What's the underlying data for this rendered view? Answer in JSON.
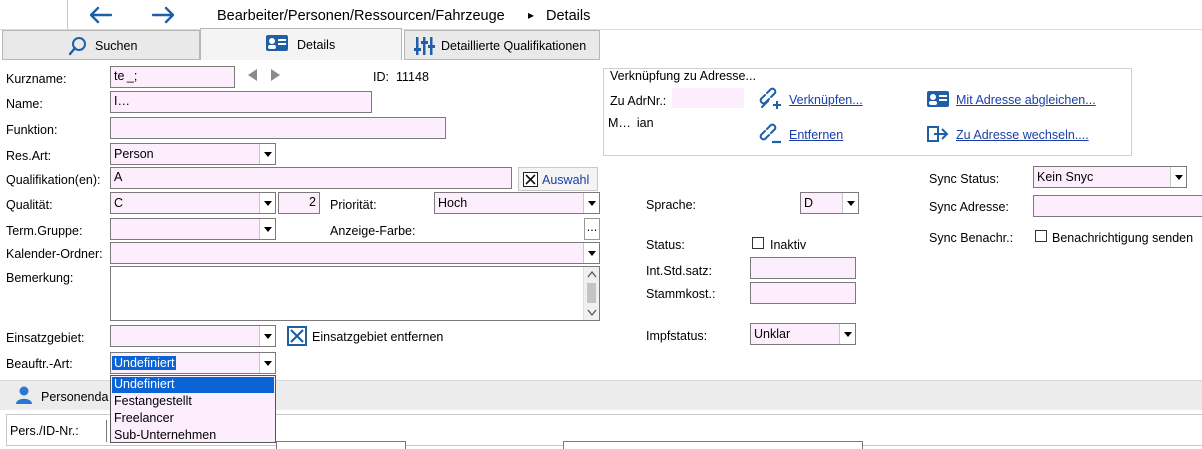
{
  "nav": {
    "back_icon": "arrow-left-icon",
    "forward_icon": "arrow-right-icon",
    "breadcrumb": "Bearbeiter/Personen/Ressourcen/Fahrzeuge",
    "crumb_separator": "▸",
    "current": "Details"
  },
  "tabs": [
    {
      "label": "Suchen",
      "icon": "search-icon"
    },
    {
      "label": "Details",
      "icon": "person-card-icon",
      "active": true
    },
    {
      "label": "Detaillierte Qualifikationen",
      "icon": "sliders-icon"
    }
  ],
  "form": {
    "kurzname_label": "Kurzname:",
    "kurzname_value": "te _;",
    "id_label": "ID:",
    "id_value": "11148",
    "name_label": "Name:",
    "name_value": "I…",
    "funktion_label": "Funktion:",
    "funktion_value": "",
    "resart_label": "Res.Art:",
    "resart_value": "Person",
    "qualifikation_label": "Qualifikation(en):",
    "qualifikation_value": "A",
    "auswahl_label": "Auswahl",
    "qualitaet_label": "Qualität:",
    "qualitaet_value": "C",
    "qualitaet_num": "2",
    "prioritaet_label": "Priorität:",
    "prioritaet_value": "Hoch",
    "termgruppe_label": "Term.Gruppe:",
    "anzeigefarbe_label": "Anzeige-Farbe:",
    "anzeigefarbe_button": "...",
    "kalender_label": "Kalender-Ordner:",
    "bemerkung_label": "Bemerkung:",
    "einsatzgebiet_label": "Einsatzgebiet:",
    "einsatzgebiet_remove": "Einsatzgebiet entfernen",
    "beauftr_label": "Beauftr.-Art:",
    "beauftr_value": "Undefiniert",
    "beauftr_options": [
      "Undefiniert",
      "Festangestellt",
      "Freelancer",
      "Sub-Unternehmen"
    ]
  },
  "address": {
    "title": "Verknüpfung zu Adresse...",
    "adrnr_label": "Zu AdrNr.:",
    "adrnr_value": "",
    "name_value": "M…  ian",
    "verknuepfen": "Verknüpfen...",
    "entfernen": "Entfernen",
    "abgleichen": "Mit Adresse abgleichen...",
    "wechseln": "Zu Adresse wechseln...."
  },
  "right": {
    "sprache_label": "Sprache:",
    "sprache_value": "D",
    "status_label": "Status:",
    "inaktiv_label": "Inaktiv",
    "stdsatz_label": "Int.Std.satz:",
    "stammkost_label": "Stammkost.:",
    "impf_label": "Impfstatus:",
    "impf_value": "Unklar",
    "sync_status_label": "Sync Status:",
    "sync_status_value": "Kein Snyc",
    "sync_adresse_label": "Sync Adresse:",
    "sync_benachr_label": "Sync Benachr.:",
    "sync_benachr_check": "Benachrichtigung senden"
  },
  "personen": {
    "section_label": "Personenda",
    "section_icon": "person-icon",
    "persid_label": "Pers./ID-Nr.:"
  },
  "colors": {
    "field_bg": "#fdeefd",
    "link": "#1a3ea8",
    "selection": "#0a64d6",
    "icon_blue": "#1f5fa8"
  }
}
